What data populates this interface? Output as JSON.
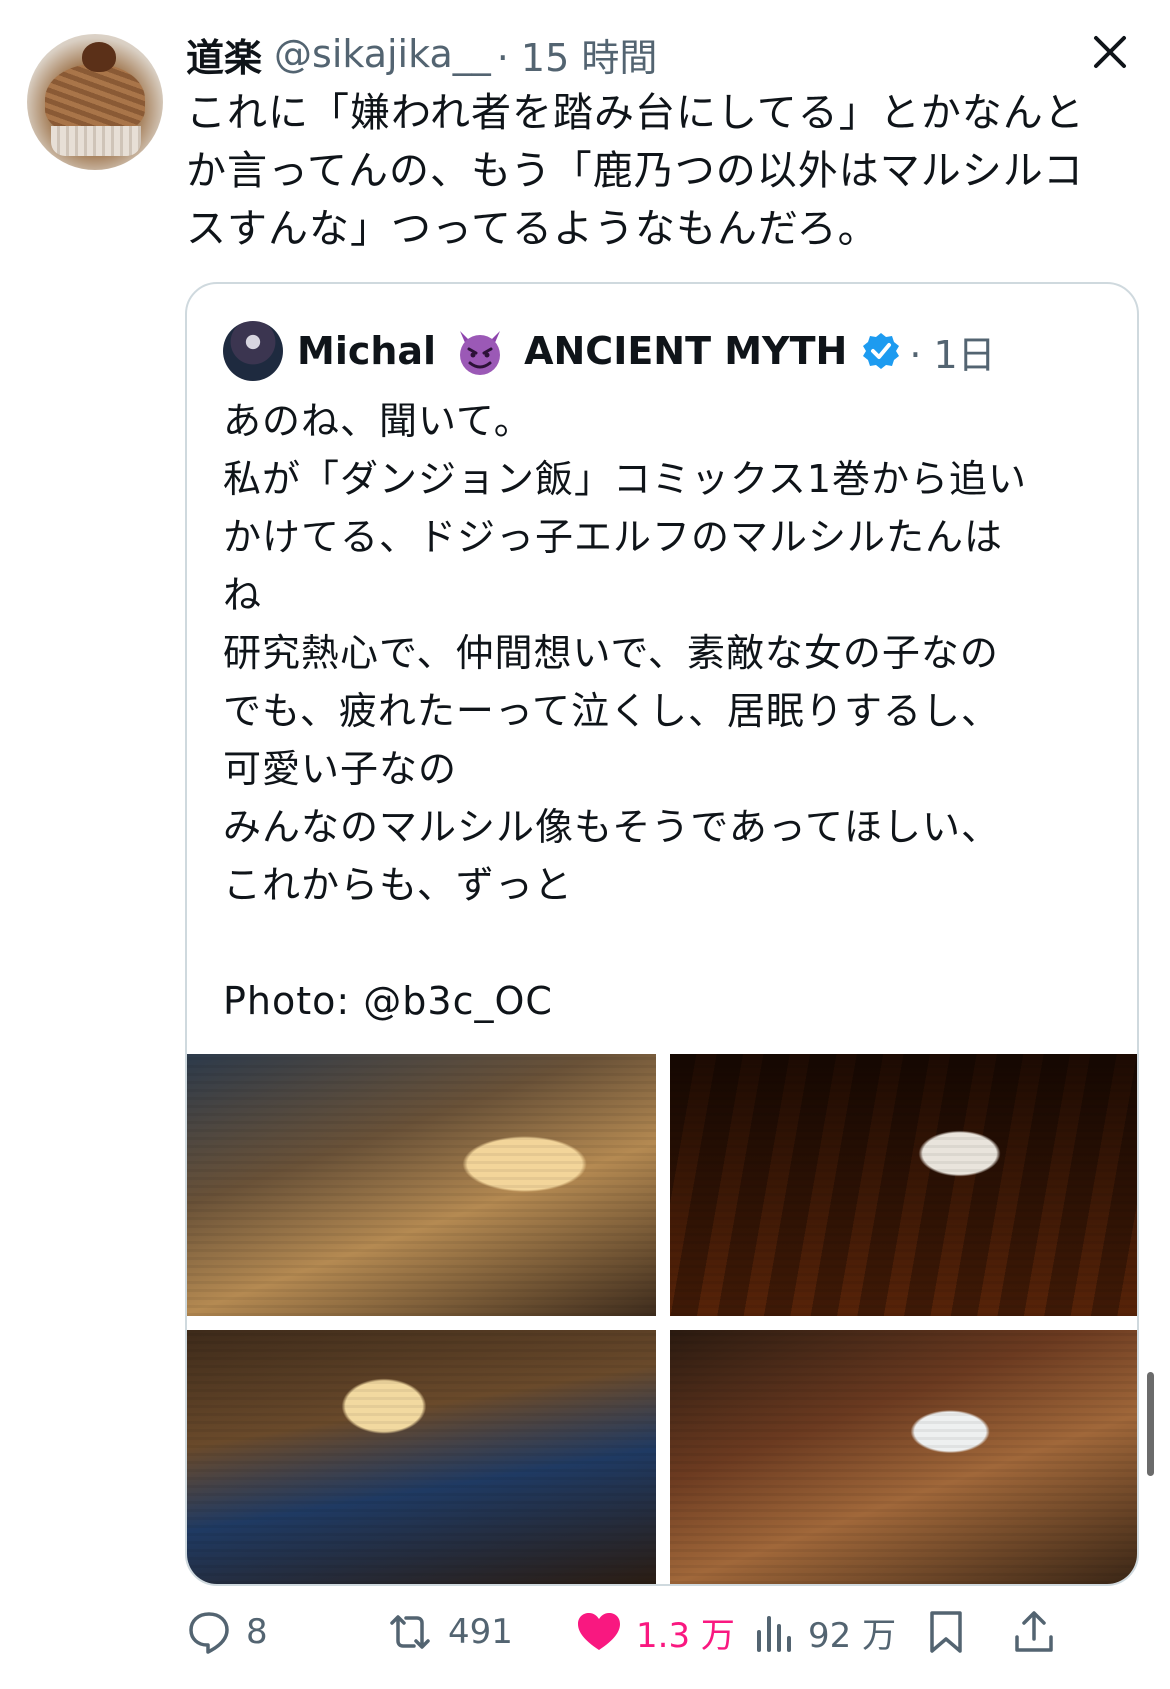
{
  "tweet": {
    "author_name": "道楽",
    "author_handle": "@sikajika__",
    "time": "· 15 時間",
    "text": "これに「嫌われ者を踏み台にしてる」とかなんと\nか言ってんの、もう「鹿乃つの以外はマルシルコ\nスすんな」つってるようなもんだろ。"
  },
  "quote": {
    "author_name": "Michal",
    "author_suffix": "ANCIENT MYTH",
    "time": "· 1日",
    "text": "あのね、聞いて。\n私が「ダンジョン飯」コミックス1巻から追い\nかけてる、ドジっ子エルフのマルシルたんは\nね\n研究熱心で、仲間想いで、素敵な女の子なの\nでも、疲れたーって泣くし、居眠りするし、\n可愛い子なの\nみんなのマルシル像もそうであってほしい、\nこれからも、ずっと\n\nPhoto: @b3c_OC"
  },
  "actions": {
    "replies": "8",
    "retweets": "491",
    "likes": "1.3 万",
    "views": "92 万"
  },
  "colors": {
    "like": "#f91880",
    "verified": "#1d9bf0",
    "devil": "#8e44ad"
  },
  "icons": [
    "close-icon",
    "devil-emoji-icon",
    "verified-badge-icon",
    "reply-icon",
    "retweet-icon",
    "like-heart-icon",
    "views-icon",
    "bookmark-icon",
    "share-icon"
  ]
}
